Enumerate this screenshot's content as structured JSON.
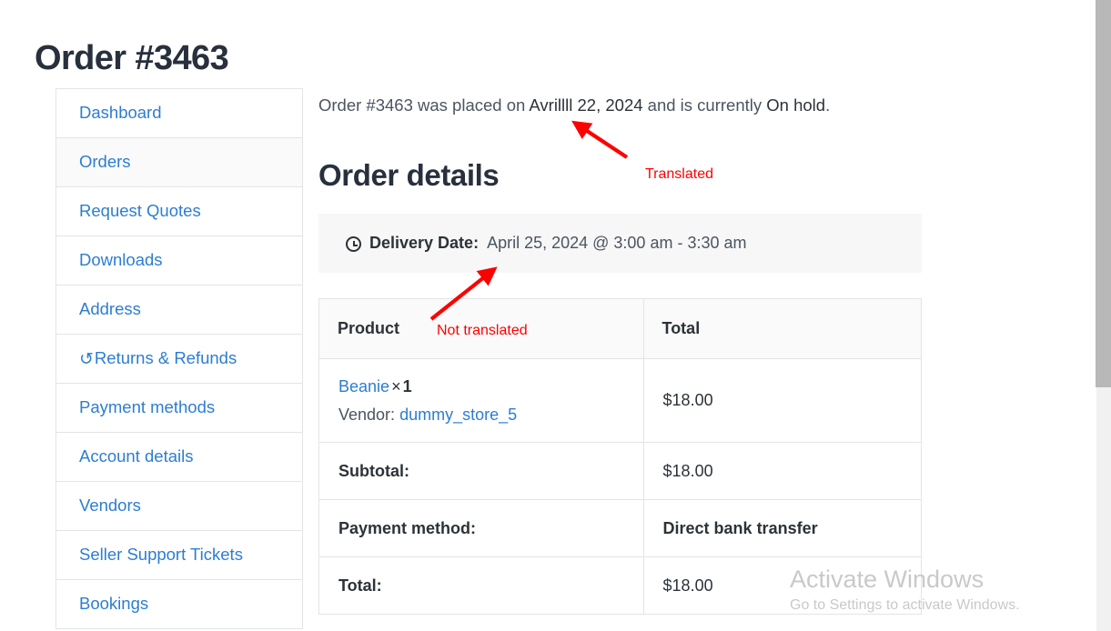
{
  "page": {
    "title": "Order #3463"
  },
  "sidebar": {
    "items": [
      {
        "label": "Dashboard",
        "icon": "",
        "active": false
      },
      {
        "label": "Orders",
        "icon": "",
        "active": true
      },
      {
        "label": "Request Quotes",
        "icon": "",
        "active": false
      },
      {
        "label": "Downloads",
        "icon": "",
        "active": false
      },
      {
        "label": "Address",
        "icon": "",
        "active": false
      },
      {
        "label": "Returns & Refunds",
        "icon": "↺",
        "active": false
      },
      {
        "label": "Payment methods",
        "icon": "",
        "active": false
      },
      {
        "label": "Account details",
        "icon": "",
        "active": false
      },
      {
        "label": "Vendors",
        "icon": "",
        "active": false
      },
      {
        "label": "Seller Support Tickets",
        "icon": "",
        "active": false
      },
      {
        "label": "Bookings",
        "icon": "",
        "active": false
      }
    ]
  },
  "main": {
    "status_line": {
      "prefix": "Order #3463 was placed on ",
      "date": "Avrillll 22, 2024",
      "middle": " and is currently ",
      "status": "On hold",
      "suffix": "."
    },
    "section_heading": "Order details",
    "delivery": {
      "icon": "clock-icon",
      "label": "Delivery Date:",
      "value": "April 25, 2024 @ 3:00 am - 3:30 am"
    },
    "table": {
      "headers": {
        "product": "Product",
        "total": "Total"
      },
      "item": {
        "name": "Beanie",
        "times": "×",
        "quantity": "1",
        "vendor_label": "Vendor:",
        "vendor_name": "dummy_store_5",
        "total": "$18.00"
      },
      "rows": [
        {
          "label": "Subtotal:",
          "value": "$18.00",
          "bold": false
        },
        {
          "label": "Payment method:",
          "value": "Direct bank transfer",
          "bold": true
        },
        {
          "label": "Total:",
          "value": "$18.00",
          "bold": false
        }
      ]
    }
  },
  "annotations": [
    {
      "text": "Translated",
      "color": "#ff0000"
    },
    {
      "text": "Not translated",
      "color": "#ff0000"
    }
  ],
  "watermark": {
    "title": "Activate Windows",
    "subtitle": "Go to Settings to activate Windows."
  },
  "colors": {
    "link": "#2d7dd2",
    "heading": "#28303d",
    "annotation": "#ff0000",
    "table_border": "#e2e4e7",
    "header_bg": "#fafafa",
    "delivery_bg": "#f7f7f7"
  }
}
